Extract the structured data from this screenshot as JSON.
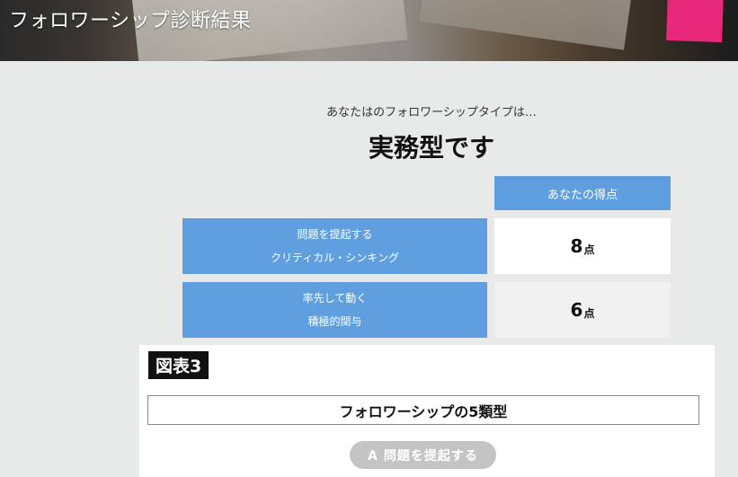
{
  "header": {
    "title": "フォロワーシップ診断結果"
  },
  "result": {
    "intro": "あなたはのフォロワーシップタイプは…",
    "type": "実務型です"
  },
  "score_table": {
    "header": "あなたの得点",
    "unit": "点",
    "rows": [
      {
        "line1": "問題を提起する",
        "line2": "クリティカル・シンキング",
        "score": "8"
      },
      {
        "line1": "率先して動く",
        "line2": "積極的関与",
        "score": "6"
      }
    ]
  },
  "figure": {
    "badge": "図表3",
    "title": "フォロワーシップの5類型",
    "button": "A  問題を提起する"
  },
  "colors": {
    "accent_blue": "#5f9fe0",
    "background": "#e8eae9"
  }
}
